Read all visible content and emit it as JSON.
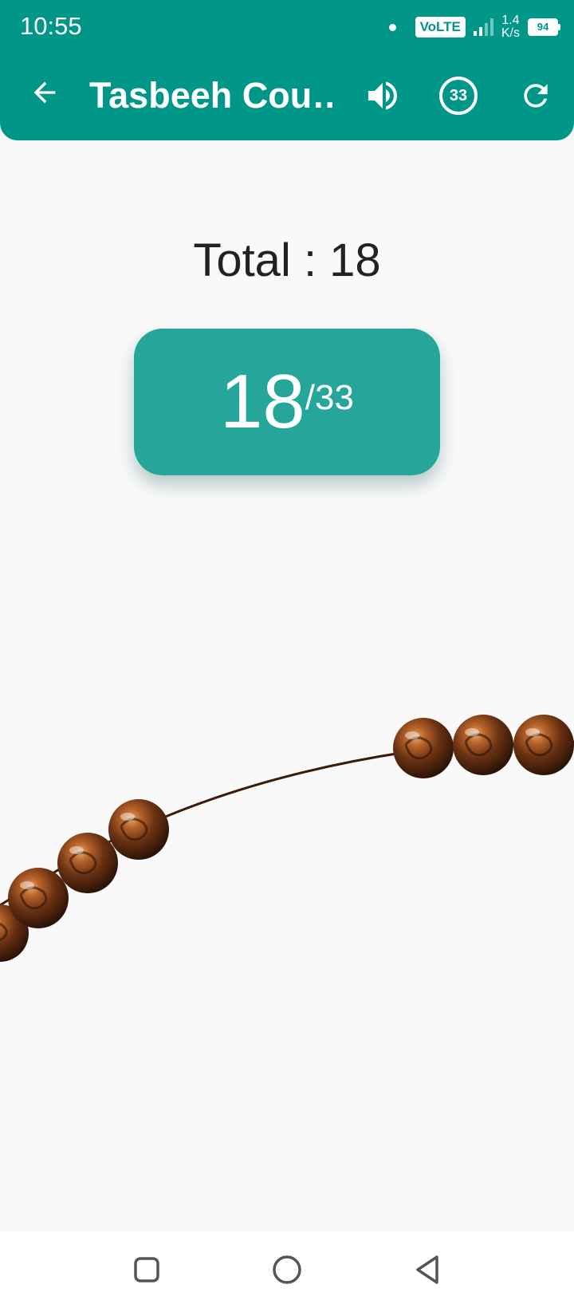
{
  "status_bar": {
    "time": "10:55",
    "network_type": "VoLTE",
    "speed_value": "1.4",
    "speed_unit": "K/s",
    "battery": "94"
  },
  "app_bar": {
    "title": "Tasbeeh Cou…",
    "target_badge": "33",
    "icons": [
      "back-arrow-icon",
      "volume-icon",
      "target-count-icon",
      "refresh-icon"
    ]
  },
  "counter": {
    "total_label": "Total : 18",
    "current": "18",
    "target": "/33"
  },
  "nav_bar": {
    "icons": [
      "recents-square-icon",
      "home-circle-icon",
      "back-triangle-icon"
    ]
  },
  "colors": {
    "primary": "#009688",
    "counter_box": "#26a69a",
    "background": "#f9f9f9",
    "bead": "#6b3212"
  }
}
